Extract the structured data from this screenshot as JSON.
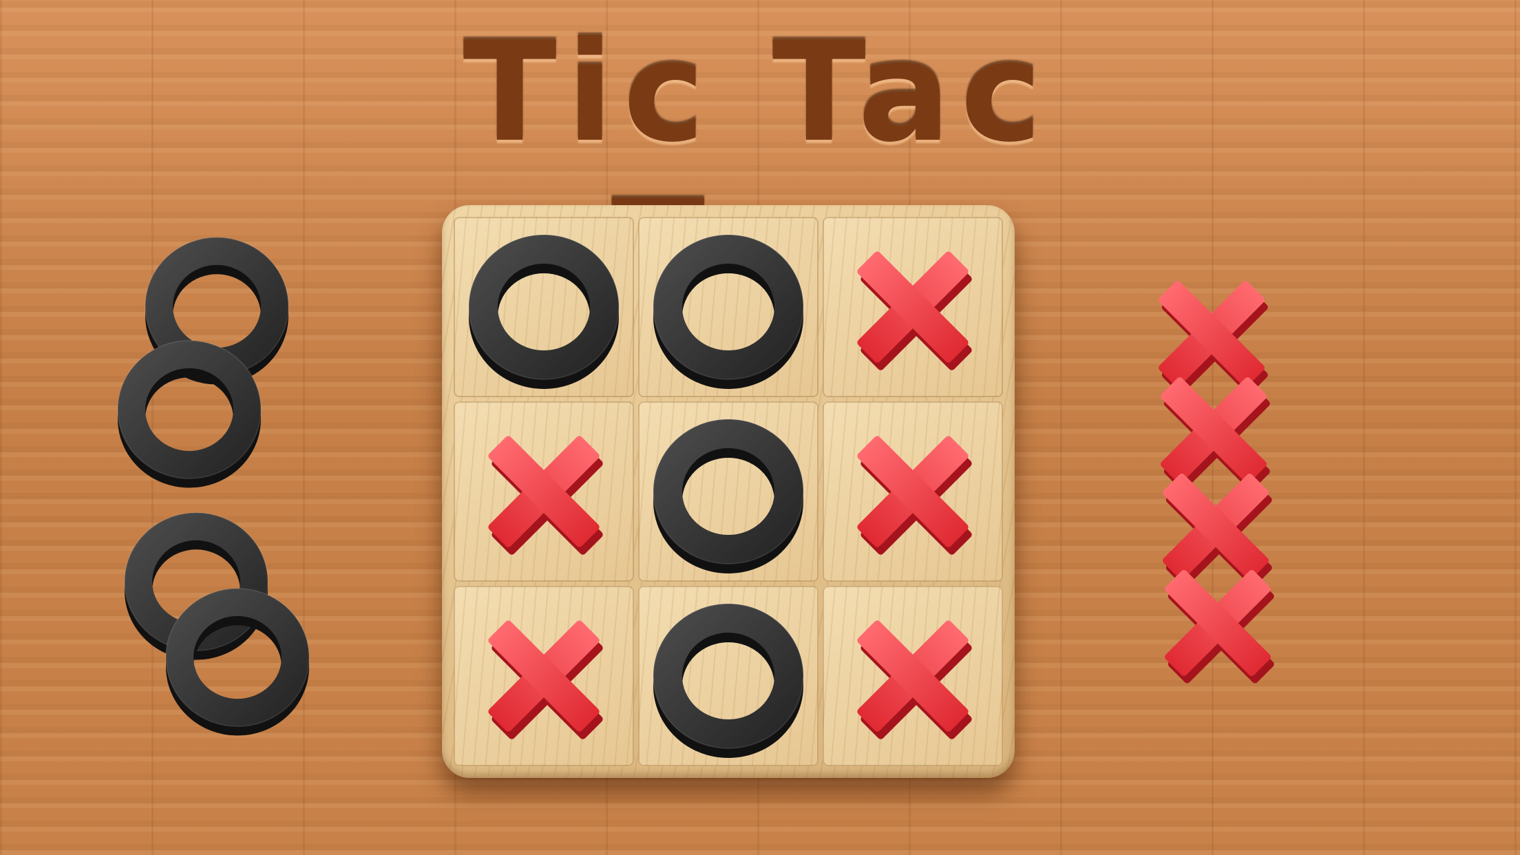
{
  "title": "Tic Tac Teo",
  "colors": {
    "x_piece": "#e8323a",
    "o_piece": "#2a2a2a",
    "board": "#e5c690",
    "table": "#c9834a",
    "title_engraving": "#7a3a14"
  },
  "board": {
    "cells": [
      [
        "O",
        "O",
        "X"
      ],
      [
        "X",
        "O",
        "X"
      ],
      [
        "X",
        "O",
        "X"
      ]
    ]
  },
  "spare_pieces": {
    "left": {
      "type": "O",
      "count": 4
    },
    "right": {
      "type": "X",
      "count": 4
    }
  }
}
